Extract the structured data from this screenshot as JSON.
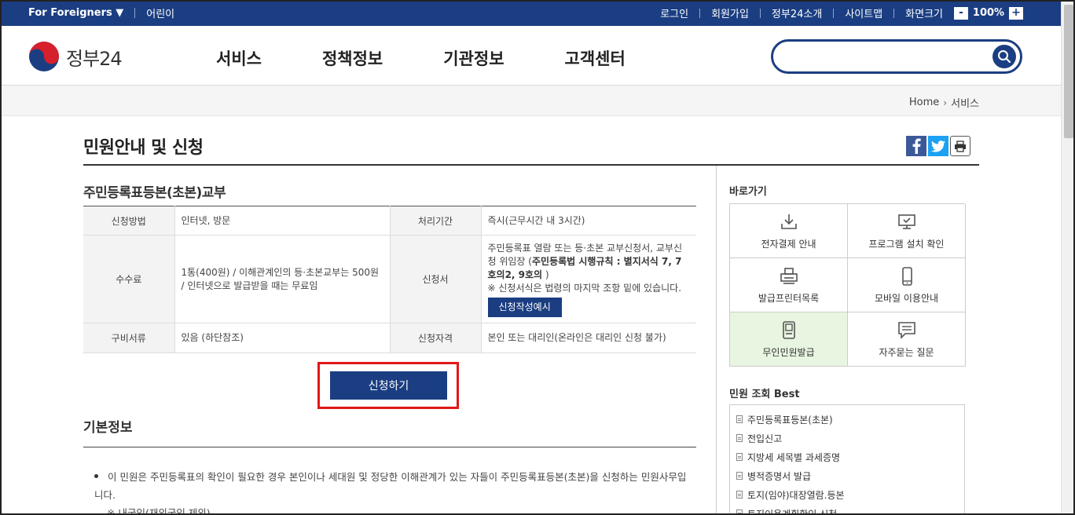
{
  "topbar": {
    "foreigners": "For Foreigners ▼",
    "kids": "어린이",
    "links": [
      "로그인",
      "회원가입",
      "정부24소개",
      "사이트맵",
      "화면크기"
    ],
    "zoom_minus": "-",
    "zoom_value": "100%",
    "zoom_plus": "+"
  },
  "header": {
    "logo_text": "정부24",
    "nav": [
      "서비스",
      "정책정보",
      "기관정보",
      "고객센터"
    ],
    "search_placeholder": ""
  },
  "breadcrumb": {
    "home": "Home",
    "current": "서비스"
  },
  "page": {
    "title": "민원안내 및 신청"
  },
  "service": {
    "title": "주민등록표등본(초본)교부",
    "rows": {
      "method_label": "신청방법",
      "method_value": "인터넷, 방문",
      "period_label": "처리기간",
      "period_value": "즉시(근무시간 내 3시간)",
      "fee_label": "수수료",
      "fee_value": "1통(400원) / 이해관계인의 등·초본교부는 500원 / 인터넷으로 발급받을 때는 무료임",
      "form_label": "신청서",
      "form_value_1": "주민등록표 열람 또는 등·초본 교부신청서, 교부신청 위임장 (",
      "form_value_bold": "주민등록법 시행규칙 : 별지서식 7, 7호의2, 9호의",
      "form_value_2": " )",
      "form_note": "※ 신청서식은 법령의 마지막 조항 밑에 있습니다.",
      "form_button": "신청작성예시",
      "docs_label": "구비서류",
      "docs_value": "있음 (하단참조)",
      "qual_label": "신청자격",
      "qual_value": "본인 또는 대리인(온라인은 대리인 신청 불가)"
    },
    "apply_button": "신청하기"
  },
  "basic": {
    "title": "기본정보",
    "text": "이 민원은 주민등록표의 확인이 필요한 경우 본인이나 세대원 및 정당한 이해관계가 있는 자들이 주민등록표등본(초본)을 신청하는 민원사무입니다.",
    "note": "※ 내국인(재외국인 제외)"
  },
  "sidebar": {
    "quick_title": "바로가기",
    "quick": [
      {
        "label": "전자결제 안내",
        "icon": "download-icon"
      },
      {
        "label": "프로그램 설치 확인",
        "icon": "monitor-icon"
      },
      {
        "label": "발급프린터목록",
        "icon": "printer-icon"
      },
      {
        "label": "모바일 이용안내",
        "icon": "mobile-icon"
      },
      {
        "label": "무인민원발급",
        "icon": "kiosk-icon"
      },
      {
        "label": "자주묻는 질문",
        "icon": "chat-icon"
      }
    ],
    "best_title": "민원 조회 Best",
    "best": [
      "주민등록표등본(초본)",
      "전입신고",
      "지방세 세목별 과세증명",
      "병적증명서 발급",
      "토지(임야)대장열람.등본",
      "토지이용계획확인 신청"
    ]
  },
  "colors": {
    "navy": "#1b3e82",
    "highlight_red": "#e01818",
    "active_green": "#e8f5e0"
  }
}
